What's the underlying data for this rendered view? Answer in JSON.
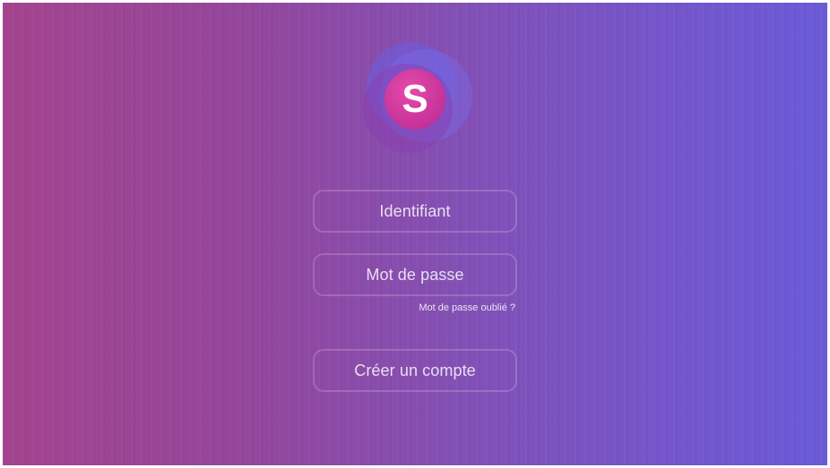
{
  "colors": {
    "background_left": "#a4448f",
    "background_right": "#6b5ad8",
    "logo_pink": "#e0359a",
    "logo_blue": "#6a5fe0"
  },
  "logo": {
    "letter": "S",
    "icon": "app-logo"
  },
  "login": {
    "username_placeholder": "Identifiant",
    "password_placeholder": "Mot de passe",
    "forgot_password": "Mot de passe oublié ?"
  },
  "signup": {
    "label": "Créer un compte"
  }
}
